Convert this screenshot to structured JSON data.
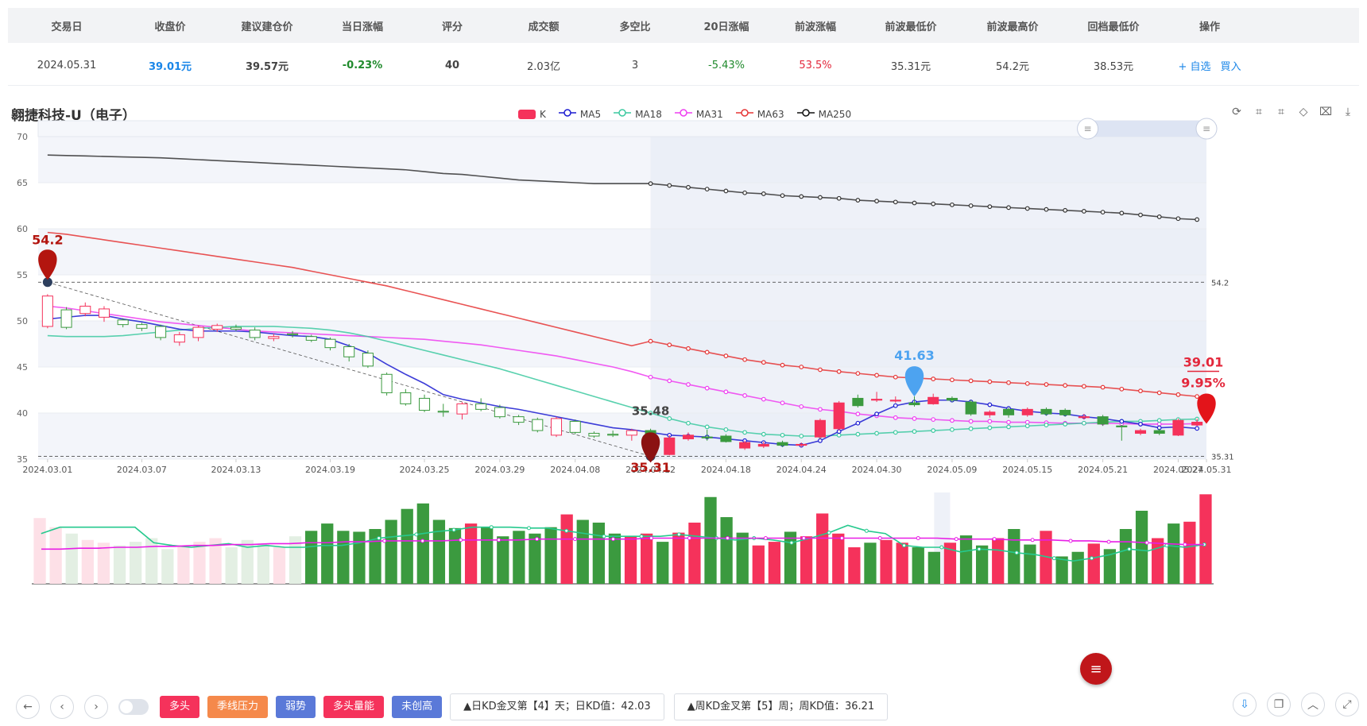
{
  "table": {
    "headers": [
      "交易日",
      "收盘价",
      "建议建仓价",
      "当日涨幅",
      "评分",
      "成交额",
      "多空比",
      "20日涨幅",
      "前波涨幅",
      "前波最低价",
      "前波最高价",
      "回档最低价",
      "操作"
    ],
    "row": {
      "date": "2024.05.31",
      "close": "39.01元",
      "suggest": "39.57元",
      "change": "-0.23%",
      "score": "40",
      "amount": "2.03亿",
      "ratio": "3",
      "change20": "-5.43%",
      "wave_change": "53.5%",
      "wave_low": "35.31元",
      "wave_high": "54.2元",
      "pullback_low": "38.53元",
      "add_label": "+ 自选",
      "buy_label": "買入"
    }
  },
  "chart_title": "翱捷科技-U（电子）",
  "legend": [
    {
      "name": "K",
      "color": "#f5325b"
    },
    {
      "name": "MA5",
      "color": "#1b1bd1"
    },
    {
      "name": "MA18",
      "color": "#3cc9a0"
    },
    {
      "name": "MA31",
      "color": "#ee3ef0"
    },
    {
      "name": "MA63",
      "color": "#e53535"
    },
    {
      "name": "MA250",
      "color": "#111111"
    }
  ],
  "toolbox": [
    "refresh-icon",
    "zoom-icon",
    "zoom-reset-icon",
    "restore-icon",
    "select-icon",
    "download-icon"
  ],
  "colors": {
    "up": "#f5325b",
    "down": "#3b9a3f",
    "grid": "#e9ecf1",
    "band": "#f3f5fa",
    "highlight": "#e8ecf6"
  },
  "chart_data": {
    "type": "candlestick",
    "yaxis_ticks": [
      35,
      40,
      45,
      50,
      55,
      60,
      65,
      70
    ],
    "ylim": [
      35,
      70
    ],
    "x_ticks": [
      "2024.03.01",
      "2024.03.07",
      "2024.03.13",
      "2024.03.19",
      "2024.03.25",
      "2024.03.29",
      "2024.04.08",
      "2024.04.12",
      "2024.04.18",
      "2024.04.24",
      "2024.04.30",
      "2024.05.09",
      "2024.05.15",
      "2024.05.21",
      "2024.05.27",
      "2024.05.31"
    ],
    "candles": [
      [
        49.4,
        52.7,
        49.2,
        52.9
      ],
      [
        51.2,
        49.3,
        49.1,
        51.5
      ],
      [
        50.8,
        51.6,
        50.5,
        52.0
      ],
      [
        50.4,
        51.3,
        49.9,
        51.6
      ],
      [
        50.1,
        49.6,
        49.3,
        50.3
      ],
      [
        49.6,
        49.2,
        48.9,
        49.8
      ],
      [
        49.4,
        48.2,
        47.9,
        49.6
      ],
      [
        47.7,
        48.5,
        47.3,
        48.8
      ],
      [
        48.2,
        49.3,
        47.8,
        49.5
      ],
      [
        49.1,
        49.5,
        48.8,
        49.7
      ],
      [
        49.3,
        49.1,
        48.9,
        49.6
      ],
      [
        49.0,
        48.2,
        47.9,
        49.3
      ],
      [
        48.1,
        48.3,
        47.8,
        48.6
      ],
      [
        48.6,
        48.5,
        48.2,
        48.9
      ],
      [
        48.3,
        47.9,
        47.7,
        48.5
      ],
      [
        48.0,
        47.1,
        46.8,
        48.2
      ],
      [
        47.2,
        46.1,
        45.6,
        47.5
      ],
      [
        46.5,
        45.1,
        44.9,
        46.8
      ],
      [
        44.2,
        42.2,
        41.9,
        44.4
      ],
      [
        42.2,
        41.0,
        40.8,
        42.6
      ],
      [
        41.6,
        40.3,
        40.1,
        42.0
      ],
      [
        40.2,
        40.1,
        39.6,
        41.0
      ],
      [
        39.9,
        41.0,
        39.3,
        41.2
      ],
      [
        41.0,
        40.4,
        40.2,
        41.6
      ],
      [
        40.6,
        39.6,
        39.4,
        40.9
      ],
      [
        39.6,
        39.0,
        38.7,
        39.8
      ],
      [
        39.3,
        38.1,
        37.9,
        39.5
      ],
      [
        37.6,
        39.4,
        37.4,
        39.6
      ],
      [
        39.1,
        37.9,
        37.7,
        39.3
      ],
      [
        37.8,
        37.5,
        37.3,
        38.0
      ],
      [
        37.7,
        37.6,
        37.4,
        38.1
      ],
      [
        37.6,
        38.1,
        37.0,
        38.3
      ],
      [
        38.1,
        35.48,
        35.31,
        38.3
      ],
      [
        35.5,
        37.3,
        35.4,
        37.6
      ],
      [
        37.2,
        37.6,
        37.0,
        37.9
      ],
      [
        37.4,
        37.3,
        37.0,
        38.2
      ],
      [
        37.5,
        36.9,
        36.8,
        37.7
      ],
      [
        36.2,
        36.8,
        36.0,
        37.0
      ],
      [
        36.4,
        36.6,
        36.2,
        36.9
      ],
      [
        36.8,
        36.5,
        36.3,
        37.0
      ],
      [
        36.5,
        36.6,
        36.3,
        36.8
      ],
      [
        37.4,
        39.2,
        37.2,
        39.4
      ],
      [
        38.3,
        41.1,
        38.1,
        41.3
      ],
      [
        41.6,
        40.8,
        40.6,
        42.0
      ],
      [
        41.4,
        41.5,
        41.2,
        42.3
      ],
      [
        41.3,
        41.4,
        41.1,
        41.8
      ],
      [
        41.1,
        40.9,
        40.7,
        41.8
      ],
      [
        41.0,
        41.7,
        40.9,
        42.1
      ],
      [
        41.6,
        41.4,
        41.2,
        41.8
      ],
      [
        41.2,
        39.9,
        39.7,
        41.4
      ],
      [
        39.8,
        40.1,
        39.5,
        40.3
      ],
      [
        40.4,
        39.8,
        39.5,
        40.6
      ],
      [
        39.8,
        40.4,
        39.6,
        40.6
      ],
      [
        40.4,
        39.9,
        39.7,
        40.6
      ],
      [
        40.3,
        39.8,
        39.6,
        40.5
      ],
      [
        39.5,
        39.6,
        39.3,
        39.9
      ],
      [
        39.6,
        38.8,
        38.6,
        39.8
      ],
      [
        38.6,
        38.5,
        37.0,
        38.7
      ],
      [
        37.8,
        38.1,
        37.6,
        38.3
      ],
      [
        38.1,
        37.8,
        37.6,
        38.3
      ],
      [
        37.6,
        39.2,
        37.5,
        39.4
      ],
      [
        38.7,
        39.01,
        38.6,
        39.4
      ]
    ],
    "ma5": [
      50.2,
      50.4,
      50.6,
      50.6,
      50.2,
      49.9,
      49.5,
      49.1,
      48.9,
      48.9,
      48.9,
      48.8,
      48.6,
      48.4,
      48.3,
      48.0,
      47.3,
      46.5,
      45.3,
      44.2,
      43.2,
      42.0,
      41.5,
      41.1,
      40.7,
      40.4,
      40.0,
      39.6,
      39.2,
      38.8,
      38.4,
      38.2,
      37.9,
      37.6,
      37.5,
      37.4,
      37.2,
      37.0,
      36.8,
      36.6,
      36.5,
      37.0,
      38.0,
      38.9,
      39.9,
      40.8,
      41.2,
      41.4,
      41.4,
      41.2,
      40.9,
      40.5,
      40.2,
      40.0,
      39.9,
      39.6,
      39.4,
      39.1,
      38.8,
      38.4,
      38.5,
      38.33
    ],
    "ma18": [
      48.4,
      48.3,
      48.3,
      48.3,
      48.4,
      48.6,
      48.8,
      49.0,
      49.2,
      49.3,
      49.4,
      49.4,
      49.4,
      49.3,
      49.2,
      49.0,
      48.7,
      48.3,
      47.8,
      47.3,
      46.8,
      46.3,
      45.8,
      45.3,
      44.8,
      44.2,
      43.6,
      43.0,
      42.4,
      41.8,
      41.2,
      40.6,
      40.0,
      39.4,
      38.9,
      38.5,
      38.2,
      37.9,
      37.7,
      37.6,
      37.5,
      37.5,
      37.6,
      37.7,
      37.8,
      37.9,
      38.0,
      38.1,
      38.2,
      38.3,
      38.4,
      38.5,
      38.6,
      38.7,
      38.8,
      38.9,
      39.0,
      39.1,
      39.1,
      39.2,
      39.3,
      39.35
    ],
    "ma31": [
      51.6,
      51.4,
      51.1,
      50.8,
      50.5,
      50.2,
      49.9,
      49.7,
      49.5,
      49.3,
      49.1,
      48.9,
      48.8,
      48.7,
      48.6,
      48.5,
      48.4,
      48.3,
      48.2,
      48.1,
      48.0,
      47.8,
      47.6,
      47.4,
      47.1,
      46.8,
      46.5,
      46.2,
      45.8,
      45.4,
      45.0,
      44.5,
      43.9,
      43.5,
      43.1,
      42.7,
      42.3,
      41.9,
      41.5,
      41.1,
      40.7,
      40.4,
      40.2,
      39.9,
      39.7,
      39.5,
      39.4,
      39.3,
      39.2,
      39.1,
      39.1,
      39.0,
      39.0,
      38.95,
      38.9,
      38.9,
      38.9,
      38.85,
      38.8,
      38.8,
      38.8,
      38.85
    ],
    "ma63": [
      59.6,
      59.4,
      59.1,
      58.8,
      58.5,
      58.2,
      57.9,
      57.6,
      57.3,
      57.0,
      56.7,
      56.4,
      56.1,
      55.8,
      55.4,
      55.0,
      54.6,
      54.2,
      53.8,
      53.3,
      52.8,
      52.3,
      51.8,
      51.3,
      50.8,
      50.3,
      49.8,
      49.3,
      48.8,
      48.3,
      47.8,
      47.3,
      47.8,
      47.4,
      47.0,
      46.6,
      46.2,
      45.8,
      45.5,
      45.2,
      45.0,
      44.7,
      44.5,
      44.3,
      44.1,
      43.9,
      43.8,
      43.7,
      43.6,
      43.5,
      43.4,
      43.3,
      43.2,
      43.1,
      43.0,
      42.9,
      42.8,
      42.6,
      42.4,
      42.2,
      42.0,
      41.8
    ],
    "ma250": [
      68.0,
      67.95,
      67.9,
      67.85,
      67.8,
      67.75,
      67.7,
      67.6,
      67.5,
      67.4,
      67.3,
      67.2,
      67.1,
      67.0,
      66.9,
      66.8,
      66.7,
      66.6,
      66.5,
      66.4,
      66.2,
      66.0,
      65.9,
      65.7,
      65.5,
      65.3,
      65.2,
      65.1,
      65.0,
      64.9,
      64.9,
      64.9,
      64.9,
      64.7,
      64.5,
      64.3,
      64.1,
      63.9,
      63.8,
      63.6,
      63.5,
      63.4,
      63.3,
      63.1,
      63.0,
      62.9,
      62.8,
      62.7,
      62.6,
      62.5,
      62.4,
      62.3,
      62.2,
      62.1,
      62.0,
      61.9,
      61.8,
      61.7,
      61.5,
      61.3,
      61.1,
      61.0
    ],
    "volume": [
      0.72,
      0.62,
      0.55,
      0.48,
      0.45,
      0.42,
      0.46,
      0.5,
      0.38,
      0.42,
      0.46,
      0.5,
      0.4,
      0.48,
      0.44,
      0.4,
      0.52,
      0.58,
      0.66,
      0.58,
      0.57,
      0.6,
      0.7,
      0.82,
      0.88,
      0.7,
      0.61,
      0.66,
      0.62,
      0.52,
      0.58,
      0.55,
      0.62,
      0.76,
      0.7,
      0.67,
      0.55,
      0.52,
      0.55,
      0.46,
      0.56,
      0.67,
      0.95,
      0.73,
      0.56,
      0.42,
      0.46,
      0.57,
      0.52,
      0.77,
      0.55,
      0.4,
      0.45,
      0.48,
      0.45,
      0.4,
      0.35,
      0.45,
      0.53,
      0.42,
      0.5,
      0.6,
      0.43,
      0.58,
      0.3,
      0.35,
      0.44,
      0.38,
      0.6,
      0.8,
      0.5,
      0.66,
      0.68,
      0.98
    ],
    "vol_ma1": [
      0.55,
      0.62,
      0.62,
      0.62,
      0.62,
      0.62,
      0.45,
      0.42,
      0.4,
      0.42,
      0.44,
      0.4,
      0.42,
      0.4,
      0.4,
      0.42,
      0.42,
      0.45,
      0.5,
      0.52,
      0.54,
      0.57,
      0.59,
      0.62,
      0.62,
      0.62,
      0.61,
      0.61,
      0.58,
      0.55,
      0.52,
      0.52,
      0.52,
      0.52,
      0.54,
      0.52,
      0.5,
      0.48,
      0.5,
      0.48,
      0.45,
      0.5,
      0.56,
      0.64,
      0.58,
      0.55,
      0.42,
      0.4,
      0.4,
      0.35,
      0.38,
      0.37,
      0.34,
      0.32,
      0.28,
      0.25,
      0.28,
      0.32,
      0.38,
      0.36,
      0.42,
      0.4,
      0.43
    ],
    "vol_ma2": [
      0.38,
      0.38,
      0.39,
      0.39,
      0.4,
      0.4,
      0.41,
      0.41,
      0.42,
      0.42,
      0.43,
      0.43,
      0.44,
      0.44,
      0.45,
      0.45,
      0.46,
      0.46,
      0.47,
      0.47,
      0.47,
      0.47,
      0.48,
      0.48,
      0.48,
      0.48,
      0.49,
      0.49,
      0.49,
      0.49,
      0.49,
      0.49,
      0.5,
      0.5,
      0.5,
      0.5,
      0.5,
      0.5,
      0.5,
      0.5,
      0.5,
      0.5,
      0.5,
      0.5,
      0.5,
      0.5,
      0.5,
      0.5,
      0.49,
      0.49,
      0.49,
      0.48,
      0.48,
      0.48,
      0.47,
      0.47,
      0.46,
      0.46,
      0.45,
      0.44,
      0.43,
      0.43
    ],
    "marks": [
      {
        "label": "54.2",
        "value": 54.2,
        "color": "#b3150f"
      },
      {
        "label": "35.48",
        "value": 35.48,
        "color": "#444444"
      },
      {
        "label": "35.31",
        "value": 35.31,
        "color": "#b3150f"
      },
      {
        "label": "41.63",
        "value": 41.63,
        "color": "#4da3f0"
      },
      {
        "label": "39.01",
        "value": 39.01,
        "color": "#e3273b"
      },
      {
        "label": "9.95%",
        "value": null,
        "color": "#e3273b"
      }
    ],
    "ref_lines": [
      54.2,
      35.31
    ]
  },
  "bottom": {
    "tags": [
      {
        "label": "多头",
        "color": "#f5325b"
      },
      {
        "label": "季线压力",
        "color": "#f5894b"
      },
      {
        "label": "弱势",
        "color": "#5a79d8"
      },
      {
        "label": "多头量能",
        "color": "#f5325b"
      },
      {
        "label": "未创高",
        "color": "#5a79d8"
      }
    ],
    "info1": "▲日KD金叉第【4】天；日KD值：42.03",
    "info2": "▲周KD金叉第【5】周；周KD值：36.21"
  }
}
